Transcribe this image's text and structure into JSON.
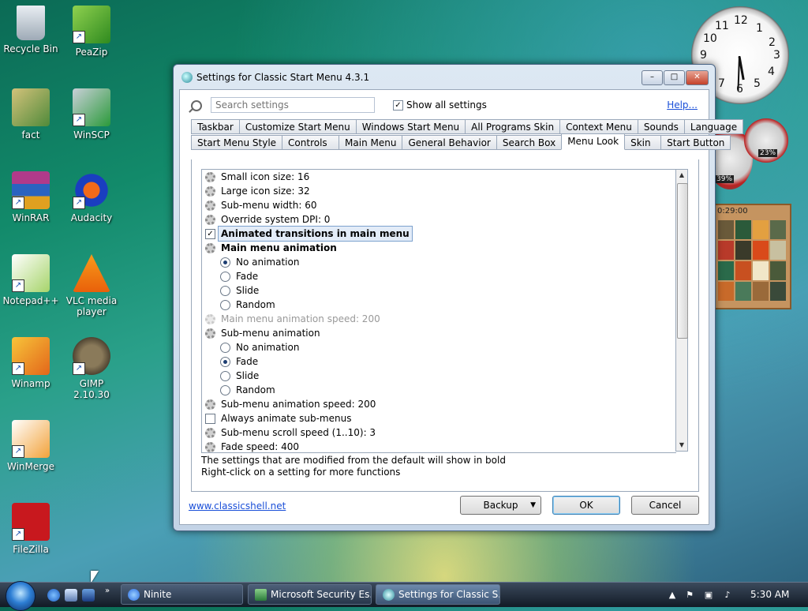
{
  "desktop": {
    "icons": [
      {
        "label": "Recycle Bin"
      },
      {
        "label": "PeaZip"
      },
      {
        "label": "fact"
      },
      {
        "label": "WinSCP"
      },
      {
        "label": "WinRAR"
      },
      {
        "label": "Audacity"
      },
      {
        "label": "Notepad++"
      },
      {
        "label": "VLC media player"
      },
      {
        "label": "Winamp"
      },
      {
        "label": "GIMP 2.10.30"
      },
      {
        "label": "WinMerge"
      },
      {
        "label": "FileZilla"
      }
    ],
    "gadgets": {
      "clock_numbers": [
        "12",
        "1",
        "2",
        "3",
        "4",
        "5",
        "6",
        "7",
        "8",
        "9",
        "10",
        "11"
      ],
      "cpu_meter_value": "39%",
      "mem_meter_value": "23%",
      "puzzle_time": "0:29:00"
    }
  },
  "window": {
    "title": "Settings for Classic Start Menu 4.3.1",
    "search": {
      "placeholder": "Search settings"
    },
    "show_all": {
      "label": "Show all settings",
      "checked": true
    },
    "help_link": "Help...",
    "tabs_row1": [
      "Taskbar",
      "Customize Start Menu",
      "Windows Start Menu",
      "All Programs Skin",
      "Context Menu",
      "Sounds",
      "Language"
    ],
    "tabs_row2": [
      "Start Menu Style",
      "Controls",
      "Main Menu",
      "General Behavior",
      "Search Box",
      "Menu Look",
      "Skin",
      "Start Button"
    ],
    "active_tab": "Menu Look",
    "settings": [
      {
        "text": "Small icon size: 16",
        "type": "gear"
      },
      {
        "text": "Large icon size: 32",
        "type": "gear"
      },
      {
        "text": "Sub-menu width: 60",
        "type": "gear"
      },
      {
        "text": "Override system DPI: 0",
        "type": "gear"
      },
      {
        "text": "Animated transitions in main menu",
        "type": "check",
        "checked": true,
        "bold": true,
        "selected": true
      },
      {
        "text": "Main menu animation",
        "type": "gear",
        "bold": true
      },
      {
        "text": "No animation",
        "type": "radio",
        "checked": true
      },
      {
        "text": "Fade",
        "type": "radio"
      },
      {
        "text": "Slide",
        "type": "radio"
      },
      {
        "text": "Random",
        "type": "radio"
      },
      {
        "text": "Main menu animation speed: 200",
        "type": "gear",
        "disabled": true
      },
      {
        "text": "Sub-menu animation",
        "type": "gear"
      },
      {
        "text": "No animation",
        "type": "radio"
      },
      {
        "text": "Fade",
        "type": "radio",
        "checked": true
      },
      {
        "text": "Slide",
        "type": "radio"
      },
      {
        "text": "Random",
        "type": "radio"
      },
      {
        "text": "Sub-menu animation speed: 200",
        "type": "gear"
      },
      {
        "text": "Always animate sub-menus",
        "type": "check"
      },
      {
        "text": "Sub-menu scroll speed (1..10): 3",
        "type": "gear"
      },
      {
        "text": "Fade speed: 400",
        "type": "gear"
      }
    ],
    "info_line1": "The settings that are modified from the default will show in bold",
    "info_line2": "Right-click on a setting for more functions",
    "website_link": "www.classicshell.net",
    "buttons": {
      "backup": "Backup",
      "ok": "OK",
      "cancel": "Cancel"
    }
  },
  "taskbar": {
    "tasks": [
      {
        "label": "Ninite"
      },
      {
        "label": "Microsoft Security Es..."
      },
      {
        "label": "Settings for Classic S...",
        "active": true
      }
    ],
    "time": "5:30 AM"
  },
  "colors": {
    "link": "#1a4fd8",
    "selection": "#e3ecf8"
  }
}
